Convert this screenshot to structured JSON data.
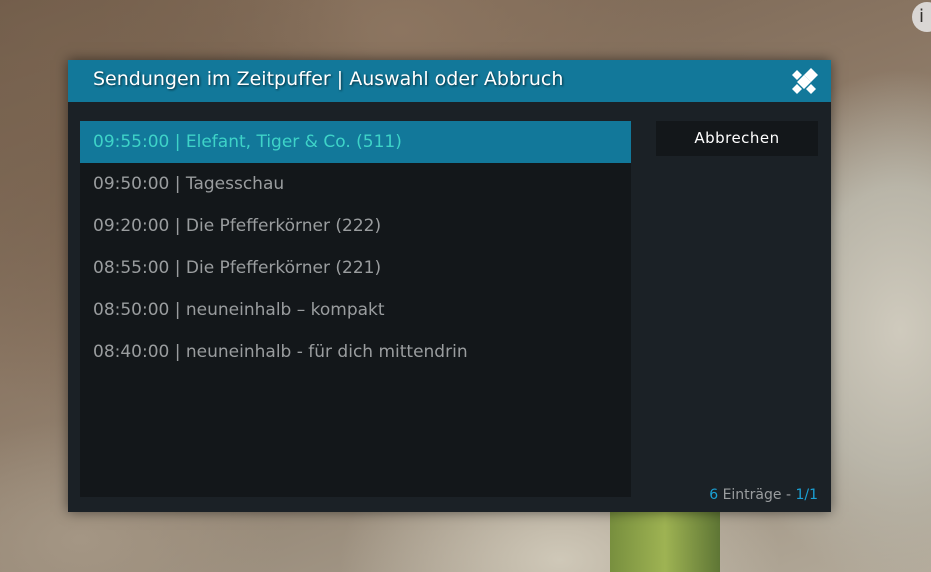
{
  "dialog": {
    "title": "Sendungen im Zeitpuffer | Auswahl oder Abbruch",
    "logo_icon": "kodi-logo-icon",
    "cancel_label": "Abbrechen",
    "items": [
      {
        "label": "09:55:00 | Elefant, Tiger & Co. (511)",
        "selected": true
      },
      {
        "label": "09:50:00 | Tagesschau",
        "selected": false
      },
      {
        "label": "09:20:00 | Die Pfefferkörner (222)",
        "selected": false
      },
      {
        "label": "08:55:00 | Die Pfefferkörner (221)",
        "selected": false
      },
      {
        "label": "08:50:00 | neuneinhalb – kompakt",
        "selected": false
      },
      {
        "label": "08:40:00 | neuneinhalb - für dich mittendrin",
        "selected": false
      }
    ],
    "footer": {
      "count": "6",
      "entries_label": " Einträge - ",
      "page": "1/1"
    }
  },
  "colors": {
    "accent": "#12789a",
    "selected_text": "#3ed3c8",
    "footer_accent": "#1aa0d4",
    "panel_bg": "#13171a",
    "dialog_bg": "#1b2126"
  },
  "corner": {
    "icon": "info-icon"
  }
}
